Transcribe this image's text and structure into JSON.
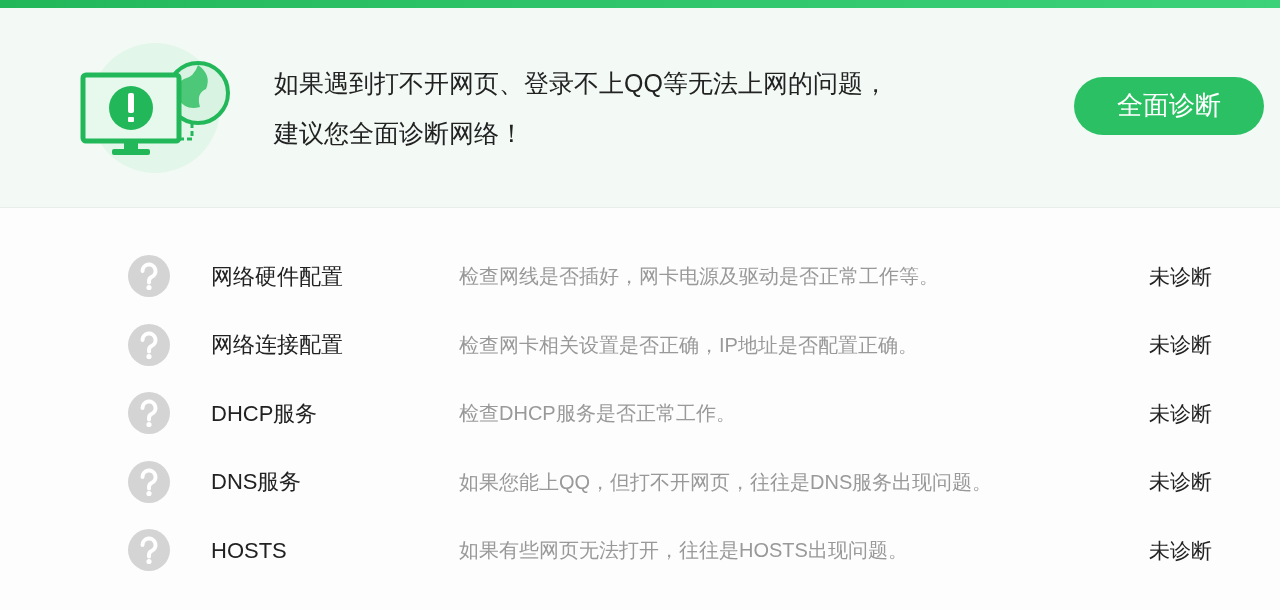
{
  "banner": {
    "lines": [
      "如果遇到打不开网页、登录不上QQ等无法上网的问题，",
      "建议您全面诊断网络！"
    ],
    "button": "全面诊断"
  },
  "checks": [
    {
      "name": "网络硬件配置",
      "description": "检查网线是否插好，网卡电源及驱动是否正常工作等。",
      "status": "未诊断"
    },
    {
      "name": "网络连接配置",
      "description": "检查网卡相关设置是否正确，IP地址是否配置正确。",
      "status": "未诊断"
    },
    {
      "name": "DHCP服务",
      "description": "检查DHCP服务是否正常工作。",
      "status": "未诊断"
    },
    {
      "name": "DNS服务",
      "description": "如果您能上QQ，但打不开网页，往往是DNS服务出现问题。",
      "status": "未诊断"
    },
    {
      "name": "HOSTS",
      "description": "如果有些网页无法打开，往往是HOSTS出现问题。",
      "status": "未诊断"
    }
  ]
}
